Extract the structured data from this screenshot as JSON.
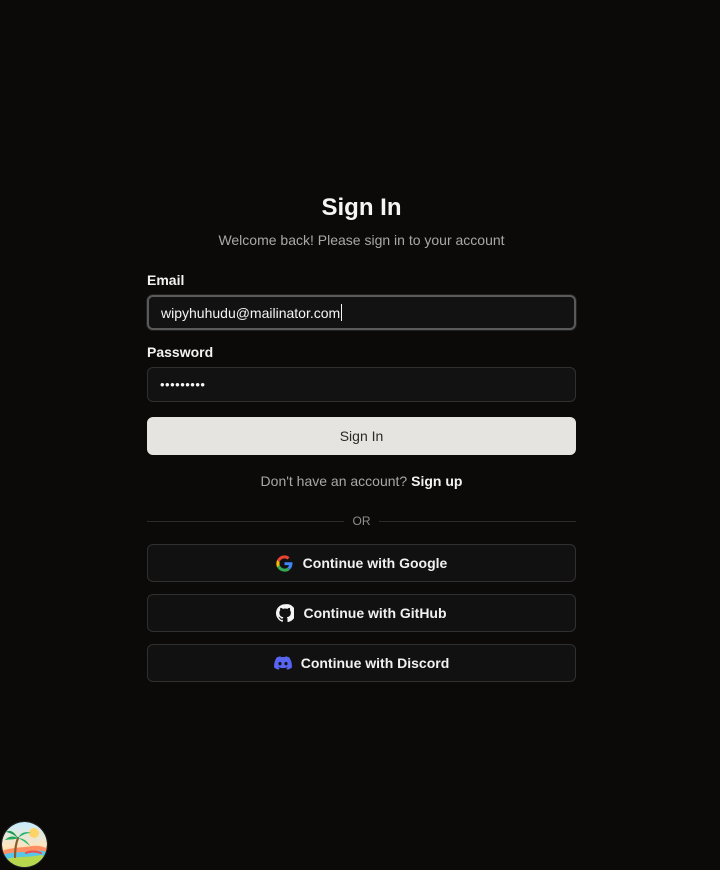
{
  "auth": {
    "title": "Sign In",
    "subtitle": "Welcome back! Please sign in to your account",
    "email": {
      "label": "Email",
      "value": "wipyhuhudu@mailinator.com"
    },
    "password": {
      "label": "Password",
      "masked_value": "•••••••••"
    },
    "sign_in_label": "Sign In",
    "signup_prompt": "Don't have an account?",
    "signup_link": "Sign up",
    "divider": "OR",
    "providers": [
      {
        "label": "Continue with Google",
        "icon": "google-icon"
      },
      {
        "label": "Continue with GitHub",
        "icon": "github-icon"
      },
      {
        "label": "Continue with Discord",
        "icon": "discord-icon"
      }
    ]
  },
  "colors": {
    "background": "#0b0a09",
    "primary_button": "#e6e4e1",
    "discord_brand": "#5865f2",
    "google_blue": "#4285f4",
    "google_red": "#ea4335",
    "google_yellow": "#fbbc05",
    "google_green": "#34a853"
  },
  "floating_avatar": {
    "icon": "beach-scene-avatar-icon"
  }
}
